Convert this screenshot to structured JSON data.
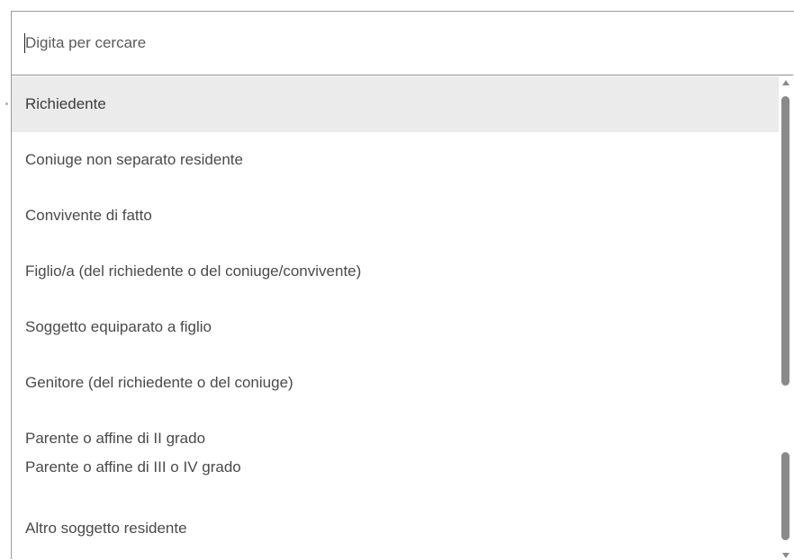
{
  "search": {
    "placeholder": "Digita per cercare",
    "value": ""
  },
  "options": [
    {
      "label": "Richiedente",
      "selected": true
    },
    {
      "label": "Coniuge non separato residente",
      "selected": false
    },
    {
      "label": "Convivente di fatto",
      "selected": false
    },
    {
      "label": "Figlio/a (del richiedente o del coniuge/convivente)",
      "selected": false
    },
    {
      "label": "Soggetto equiparato a figlio",
      "selected": false
    },
    {
      "label": "Genitore (del richiedente o del coniuge)",
      "selected": false
    },
    {
      "label": "Parente o affine di II grado",
      "selected": false
    },
    {
      "label": "Parente o affine di III o IV grado",
      "selected": false
    },
    {
      "label": "Altro soggetto residente",
      "selected": false
    }
  ],
  "colors": {
    "selected_background": "#ebebeb",
    "text": "#4a4a4a",
    "border": "#9a9a9a",
    "scrollbar": "#8a8a8a"
  }
}
